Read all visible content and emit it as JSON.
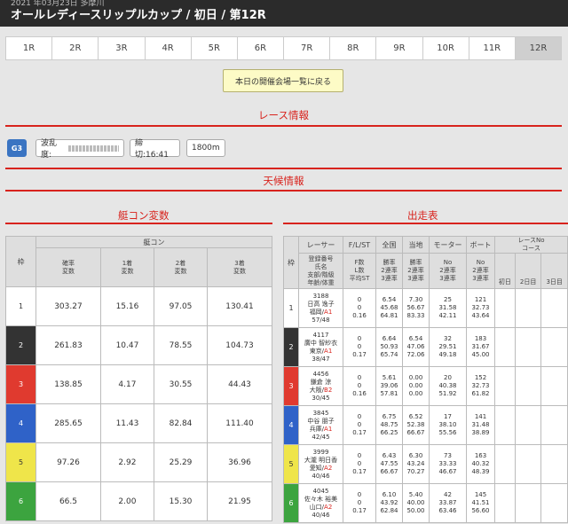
{
  "header": {
    "subtitle": "2021 年03月23日 多摩川",
    "title": "オールレディースリップルカップ / 初日 / 第12R"
  },
  "race_tabs": [
    "1R",
    "2R",
    "3R",
    "4R",
    "5R",
    "6R",
    "7R",
    "8R",
    "9R",
    "10R",
    "11R",
    "12R"
  ],
  "active_tab": "12R",
  "back_button": "本日の開催会場一覧に戻る",
  "race_info": {
    "heading": "レース情報",
    "grade": "G3",
    "wave_label": "波乱度:",
    "deadline": "締切:16:41",
    "distance": "1800m"
  },
  "weather": {
    "heading": "天候情報"
  },
  "teikon": {
    "heading": "艇コン変数",
    "col_waku": "枠",
    "col_group": "艇コン",
    "cols": [
      "確率\n変数",
      "1着\n変数",
      "2着\n変数",
      "3着\n変数"
    ],
    "rows": [
      {
        "waku": "1",
        "v": [
          "303.27",
          "15.16",
          "97.05",
          "130.41"
        ]
      },
      {
        "waku": "2",
        "v": [
          "261.83",
          "10.47",
          "78.55",
          "104.73"
        ]
      },
      {
        "waku": "3",
        "v": [
          "138.85",
          "4.17",
          "30.55",
          "44.43"
        ]
      },
      {
        "waku": "4",
        "v": [
          "285.65",
          "11.43",
          "82.84",
          "111.40"
        ]
      },
      {
        "waku": "5",
        "v": [
          "97.26",
          "2.92",
          "25.29",
          "36.96"
        ]
      },
      {
        "waku": "6",
        "v": [
          "66.5",
          "2.00",
          "15.30",
          "21.95"
        ]
      }
    ]
  },
  "shusso": {
    "heading": "出走表",
    "col_waku": "枠",
    "col_racer": "レーサー",
    "col_racer_sub": "登録番号\n氏名\n支部/階級\n年齢/体重",
    "col_fl": "F/L/ST",
    "col_fl_sub": "F数\nL数\n平均ST",
    "col_zenkoku": "全国",
    "col_tochi": "当地",
    "col_motor": "モーター",
    "col_boat": "ボート",
    "col_rate_sub": "勝率\n2連率\n3連率",
    "col_no_sub": "No\n2連率\n3連率",
    "col_recent": "レースNo\nコース",
    "days": [
      "初日",
      "2日目",
      "3日目"
    ],
    "rows": [
      {
        "waku": "1",
        "reg": "3188",
        "name": "日高 逸子",
        "branch": "福岡/",
        "cls": "A1",
        "age": "57/48",
        "f": "0",
        "l": "0",
        "st": "0.16",
        "z": [
          "6.54",
          "45.68",
          "64.81"
        ],
        "t": [
          "7.30",
          "56.67",
          "83.33"
        ],
        "m": [
          "25",
          "31.58",
          "42.11"
        ],
        "b": [
          "121",
          "32.73",
          "43.64"
        ]
      },
      {
        "waku": "2",
        "reg": "4117",
        "name": "廣中 智紗衣",
        "branch": "東京/",
        "cls": "A1",
        "age": "38/47",
        "f": "0",
        "l": "0",
        "st": "0.17",
        "z": [
          "6.64",
          "50.93",
          "65.74"
        ],
        "t": [
          "6.54",
          "47.06",
          "72.06"
        ],
        "m": [
          "32",
          "29.51",
          "49.18"
        ],
        "b": [
          "183",
          "31.67",
          "45.00"
        ]
      },
      {
        "waku": "3",
        "reg": "4456",
        "name": "鎌倉 涼",
        "branch": "大阪/",
        "cls": "B2",
        "age": "30/45",
        "f": "0",
        "l": "0",
        "st": "0.16",
        "z": [
          "5.61",
          "39.06",
          "57.81"
        ],
        "t": [
          "0.00",
          "0.00",
          "0.00"
        ],
        "m": [
          "20",
          "40.38",
          "51.92"
        ],
        "b": [
          "152",
          "32.73",
          "61.82"
        ]
      },
      {
        "waku": "4",
        "reg": "3845",
        "name": "中谷 朋子",
        "branch": "兵庫/",
        "cls": "A1",
        "age": "42/45",
        "f": "0",
        "l": "0",
        "st": "0.17",
        "z": [
          "6.75",
          "48.75",
          "66.25"
        ],
        "t": [
          "6.52",
          "52.38",
          "66.67"
        ],
        "m": [
          "17",
          "38.10",
          "55.56"
        ],
        "b": [
          "141",
          "31.48",
          "38.89"
        ]
      },
      {
        "waku": "5",
        "reg": "3999",
        "name": "大瀧 明日香",
        "branch": "愛知/",
        "cls": "A2",
        "age": "40/46",
        "f": "0",
        "l": "0",
        "st": "0.17",
        "z": [
          "6.43",
          "47.55",
          "66.67"
        ],
        "t": [
          "6.30",
          "43.24",
          "70.27"
        ],
        "m": [
          "73",
          "33.33",
          "46.67"
        ],
        "b": [
          "163",
          "40.32",
          "48.39"
        ]
      },
      {
        "waku": "6",
        "reg": "4045",
        "name": "佐々木 裕美",
        "branch": "山口/",
        "cls": "A2",
        "age": "40/46",
        "f": "0",
        "l": "0",
        "st": "0.17",
        "z": [
          "6.10",
          "43.92",
          "62.84"
        ],
        "t": [
          "5.40",
          "40.00",
          "50.00"
        ],
        "m": [
          "42",
          "33.87",
          "63.46"
        ],
        "b": [
          "145",
          "41.51",
          "56.60"
        ]
      }
    ]
  }
}
